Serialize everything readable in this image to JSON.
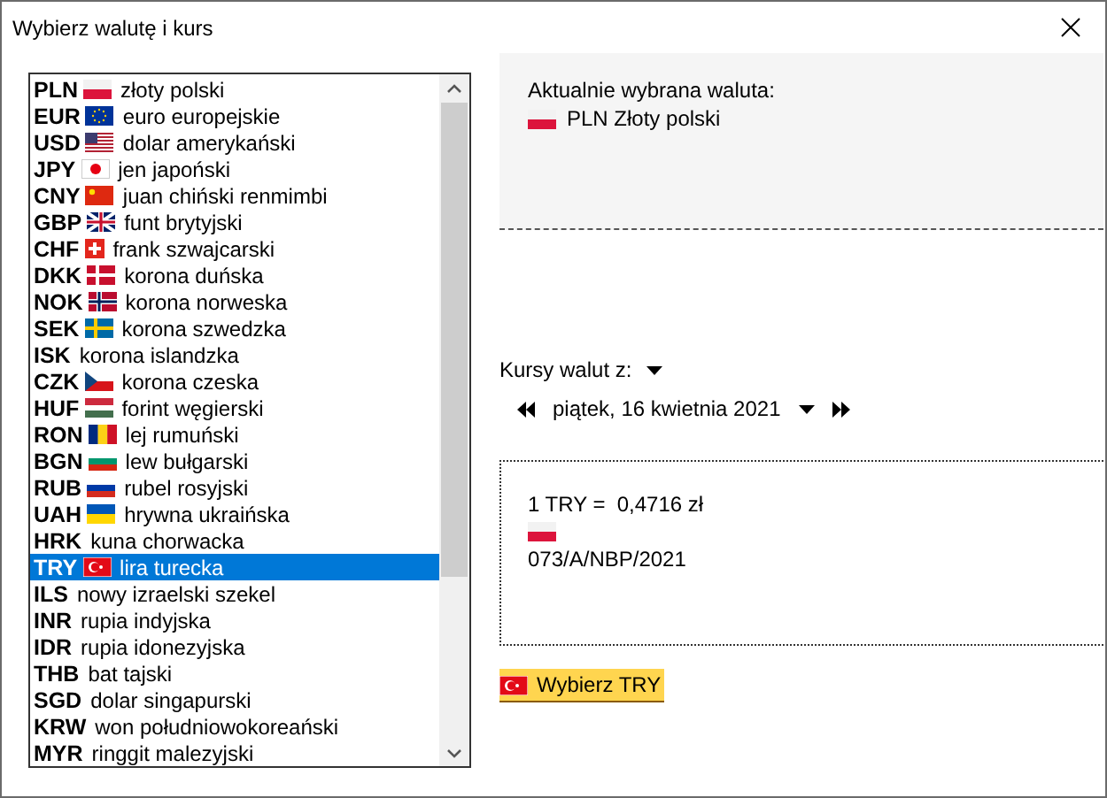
{
  "window": {
    "title": "Wybierz walutę i kurs"
  },
  "currencies": [
    {
      "code": "PLN",
      "flag": {
        "kind": "pl"
      },
      "name": "złoty polski",
      "selected": false
    },
    {
      "code": "EUR",
      "flag": {
        "kind": "eu"
      },
      "name": "euro europejskie",
      "selected": false
    },
    {
      "code": "USD",
      "flag": {
        "kind": "us"
      },
      "name": "dolar amerykański",
      "selected": false
    },
    {
      "code": "JPY",
      "flag": {
        "kind": "jp"
      },
      "name": "jen japoński",
      "selected": false
    },
    {
      "code": "CNY",
      "flag": {
        "kind": "cn"
      },
      "name": "juan chiński renmimbi",
      "selected": false
    },
    {
      "code": "GBP",
      "flag": {
        "kind": "gb"
      },
      "name": "funt brytyjski",
      "selected": false
    },
    {
      "code": "CHF",
      "flag": {
        "kind": "ch"
      },
      "name": "frank szwajcarski",
      "selected": false
    },
    {
      "code": "DKK",
      "flag": {
        "kind": "dk"
      },
      "name": "korona duńska",
      "selected": false
    },
    {
      "code": "NOK",
      "flag": {
        "kind": "no"
      },
      "name": "korona norweska",
      "selected": false
    },
    {
      "code": "SEK",
      "flag": {
        "kind": "se"
      },
      "name": "korona szwedzka",
      "selected": false
    },
    {
      "code": "ISK",
      "name": "korona islandzka",
      "selected": false
    },
    {
      "code": "CZK",
      "flag": {
        "kind": "cz"
      },
      "name": "korona czeska",
      "selected": false
    },
    {
      "code": "HUF",
      "flag": {
        "kind": "hu"
      },
      "name": "forint węgierski",
      "selected": false
    },
    {
      "code": "RON",
      "flag": {
        "kind": "ro"
      },
      "name": "lej rumuński",
      "selected": false
    },
    {
      "code": "BGN",
      "flag": {
        "kind": "bg"
      },
      "name": "lew bułgarski",
      "selected": false
    },
    {
      "code": "RUB",
      "flag": {
        "kind": "ru"
      },
      "name": "rubel rosyjski",
      "selected": false
    },
    {
      "code": "UAH",
      "flag": {
        "kind": "ua"
      },
      "name": "hrywna ukraińska",
      "selected": false
    },
    {
      "code": "HRK",
      "name": "kuna chorwacka",
      "selected": false
    },
    {
      "code": "TRY",
      "flag": {
        "kind": "tr"
      },
      "name": "lira turecka",
      "selected": true
    },
    {
      "code": "ILS",
      "name": "nowy izraelski szekel",
      "selected": false
    },
    {
      "code": "INR",
      "name": "rupia indyjska",
      "selected": false
    },
    {
      "code": "IDR",
      "name": "rupia idonezyjska",
      "selected": false
    },
    {
      "code": "THB",
      "name": "bat tajski",
      "selected": false
    },
    {
      "code": "SGD",
      "name": "dolar singapurski",
      "selected": false
    },
    {
      "code": "KRW",
      "name": "won południowokoreański",
      "selected": false
    },
    {
      "code": "MYR",
      "name": "ringgit malezyjski",
      "selected": false
    }
  ],
  "current": {
    "label": "Aktualnie wybrana waluta:",
    "flag": {
      "kind": "pl"
    },
    "value": "PLN Złoty polski"
  },
  "rates_source": {
    "label": "Kursy walut z:"
  },
  "date": {
    "value": "piątek, 16 kwietnia 2021"
  },
  "rate": {
    "text": "1 TRY =  0,4716 zł",
    "flag": {
      "kind": "pl"
    },
    "table": "073/A/NBP/2021"
  },
  "select_button": {
    "flag": {
      "kind": "tr"
    },
    "label": "Wybierz TRY"
  }
}
